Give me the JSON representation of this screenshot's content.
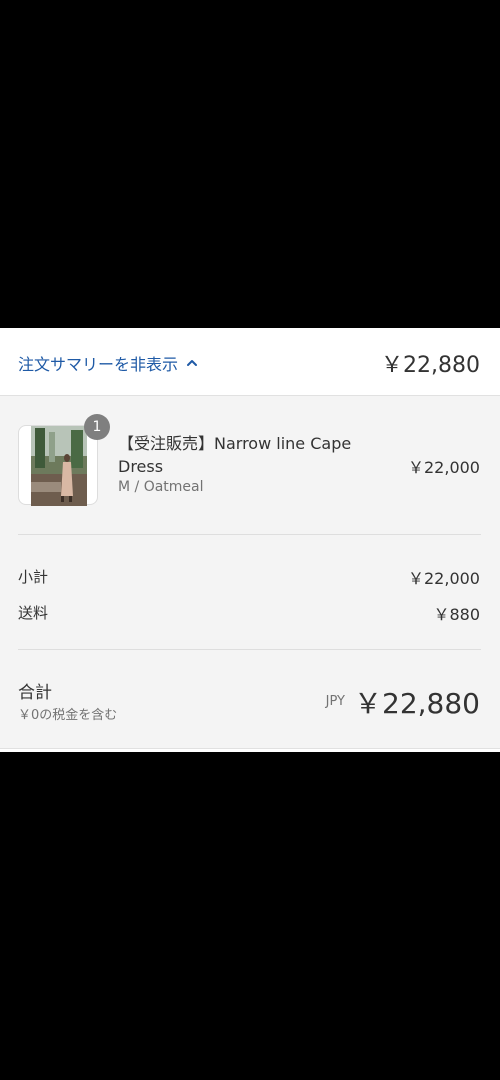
{
  "summary_toggle": {
    "label": "注文サマリーを非表示",
    "total": "￥22,880"
  },
  "line_item": {
    "quantity": "1",
    "name": "【受注販売】Narrow line Cape Dress",
    "variant": "M / Oatmeal",
    "price": "￥22,000"
  },
  "costs": {
    "subtotal_label": "小計",
    "subtotal_value": "￥22,000",
    "shipping_label": "送料",
    "shipping_value": "￥880"
  },
  "total": {
    "label": "合計",
    "tax_note": "￥0の税金を含む",
    "currency": "JPY",
    "amount": "￥22,880"
  },
  "icons": {
    "toggle": "chevron-up-icon"
  },
  "colors": {
    "link": "#1f5aa6",
    "panel_bg": "#f4f4f4",
    "badge": "#7f7f7f"
  }
}
